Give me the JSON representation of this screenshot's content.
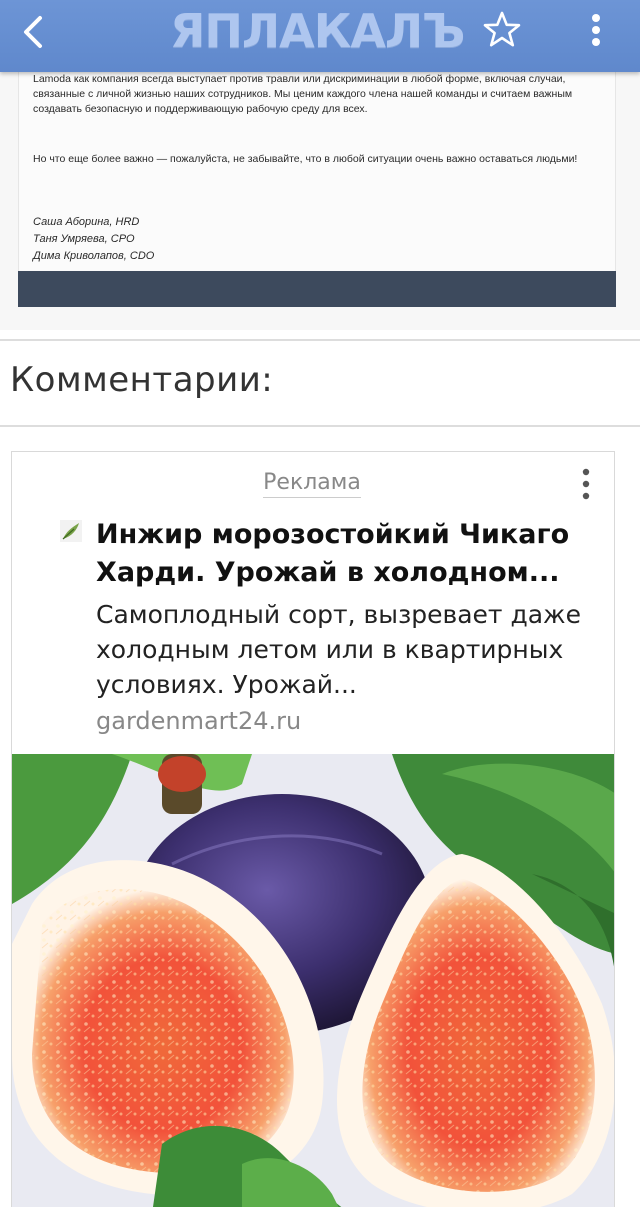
{
  "app": {
    "logo_text": "ЯПЛАКАЛЪ",
    "back_icon": "chevron-left-icon",
    "favorite_icon": "star-outline-icon",
    "menu_icon": "more-vertical-icon",
    "bar_color": "#6590d2"
  },
  "letter": {
    "paragraph1": "Lamoda как компания всегда выступает против травли или дискриминации в любой форме, включая случаи, связанные с личной жизнью наших сотрудников. Мы ценим каждого члена нашей команды и считаем важным создавать безопасную и поддерживающую рабочую среду для всех.",
    "paragraph2": "Но что еще более важно — пожалуйста, не забывайте, что в любой ситуации очень важно оставаться людьми!",
    "signatures": [
      "Саша Аборина, HRD",
      "Таня Умряева, CPO",
      "Дима Криволапов, CDO"
    ],
    "footer_color": "#3d4a5d"
  },
  "comments": {
    "title": "Комментарии:"
  },
  "ad": {
    "label": "Реклама",
    "headline_line1": "Инжир морозостойкий Чикаго",
    "headline_line2": "Харди. Урожай в холодном...",
    "description_line1": "Самоплодный сорт, вызревает даже",
    "description_line2": "холодным летом или в квартирных",
    "description_line3": "условиях. Урожай...",
    "domain": "gardenmart24.ru",
    "image_subject": "cut fig halves with whole purple fig and green leaves"
  }
}
